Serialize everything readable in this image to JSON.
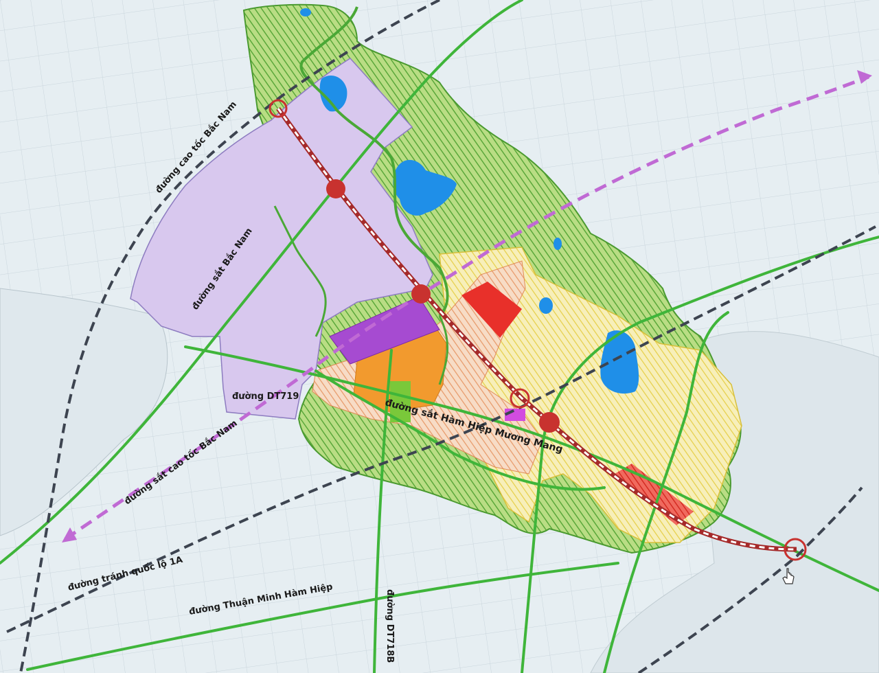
{
  "map": {
    "labels": {
      "cao_toc_bac_nam_north": "đường cao tốc Bắc Nam",
      "sat_bac_nam": "đường sắt Bắc Nam",
      "dt719": "đường DT719",
      "sat_cao_toc": "đường sắt cao tốc Bắc Nam",
      "tranh_1a": "đường tránh quốc lộ 1A",
      "thuan_minh": "đường Thuận Minh Hàm Hiệp",
      "dt718b": "đường DT718B",
      "ham_hiep": "đường sắt Hàm Hiệp Mương Mang"
    },
    "colors": {
      "background": "#e6eef2",
      "grid": "#c9d5dc",
      "agriculture_green": "#a6d46a",
      "hatch_green": "#5aa83a",
      "urban_lavender": "#d8c8ee",
      "residential_yellow": "#f3e79a",
      "industrial_red": "#e8302a",
      "orange_zone": "#f29a2e",
      "purple_zone": "#a64bd1",
      "water_blue": "#1f8fe8",
      "road_green": "#3fb53a",
      "expressway_dark": "#3d4450",
      "railway_purple": "#c06ad4",
      "station_red": "#c8322f"
    },
    "icons": [
      "hand-cursor-icon"
    ]
  }
}
